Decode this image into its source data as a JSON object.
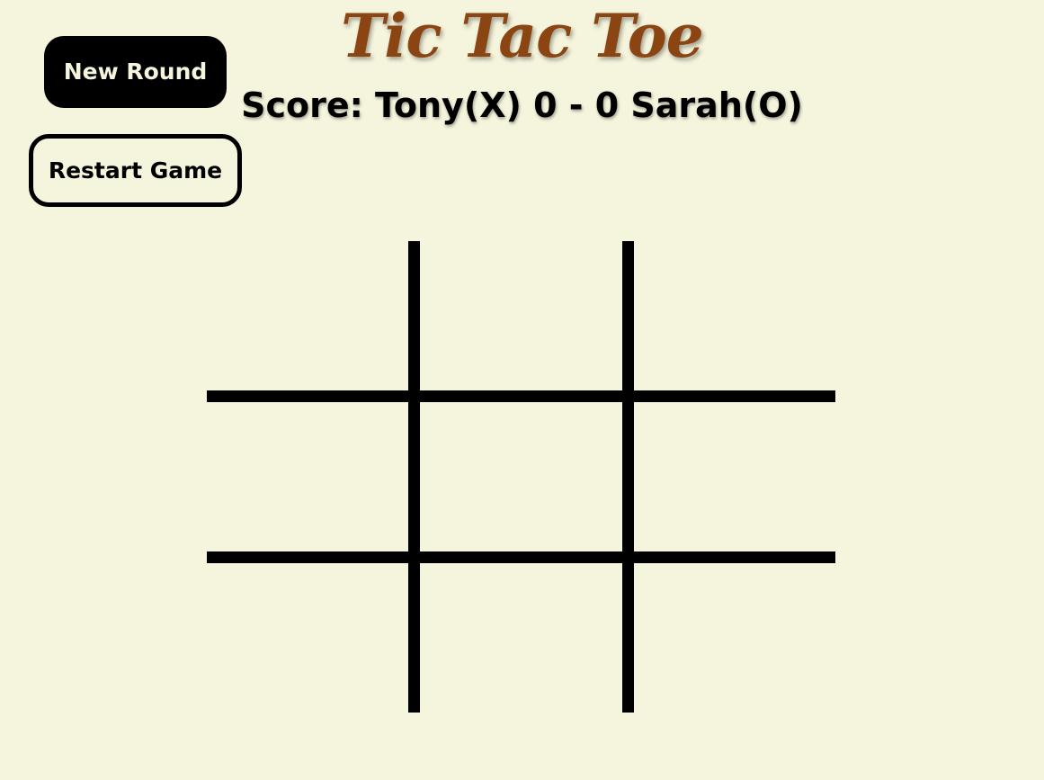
{
  "game": {
    "title": "Tic Tac Toe",
    "score_text": "Score: Tony(X) 0 - 0 Sarah(O)",
    "player_x": {
      "name": "Tony",
      "mark": "X",
      "score": 0
    },
    "player_o": {
      "name": "Sarah",
      "mark": "O",
      "score": 0
    }
  },
  "controls": {
    "new_round_label": "New Round",
    "restart_label": "Restart Game"
  },
  "board": {
    "cells": [
      "",
      "",
      "",
      "",
      "",
      "",
      "",
      "",
      ""
    ]
  },
  "colors": {
    "background": "#f5f4dc",
    "title": "#8b4513",
    "lines": "#000000",
    "button_dark": "#000000"
  }
}
